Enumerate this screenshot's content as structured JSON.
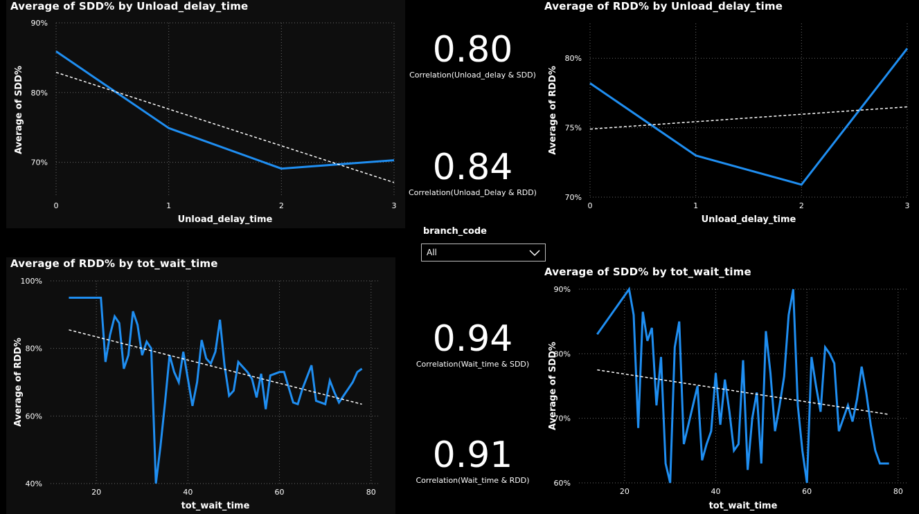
{
  "colors": {
    "line": "#1f8ef1",
    "trend": "#ffffff",
    "grid": "#6a6a6a",
    "panel": "#0e0e0e"
  },
  "cards": [
    {
      "value": "0.80",
      "label": "Correlation(Unload_delay & SDD)"
    },
    {
      "value": "0.84",
      "label": "Correlation(Unload_Delay & RDD)"
    },
    {
      "value": "0.94",
      "label": "Correlation(Wait_time & SDD)"
    },
    {
      "value": "0.91",
      "label": "Correlation(Wait_time & RDD)"
    }
  ],
  "slicer": {
    "title": "branch_code",
    "value": "All",
    "icon": "chevron-down-icon"
  },
  "chart_data": [
    {
      "type": "line",
      "title": "Average of SDD% by Unload_delay_time",
      "xlabel": "Unload_delay_time",
      "ylabel": "Average of SDD%",
      "xlim": [
        0,
        3
      ],
      "ylim": [
        65,
        90
      ],
      "xticks": [
        "0",
        "1",
        "2",
        "3"
      ],
      "yticks": [
        {
          "v": 70,
          "t": "70%"
        },
        {
          "v": 80,
          "t": "80%"
        },
        {
          "v": 90,
          "t": "90%"
        }
      ],
      "x": [
        0,
        1,
        2,
        3
      ],
      "series": [
        {
          "values": [
            85.9,
            74.9,
            69.1,
            70.3
          ]
        }
      ],
      "trend": [
        [
          0,
          82.9
        ],
        [
          3,
          67.1
        ]
      ],
      "grid": true
    },
    {
      "type": "line",
      "title": "Average of RDD% by Unload_delay_time",
      "xlabel": "Unload_delay_time",
      "ylabel": "Average of RDD%",
      "xlim": [
        0,
        3
      ],
      "ylim": [
        70,
        82.5
      ],
      "xticks": [
        "0",
        "1",
        "2",
        "3"
      ],
      "yticks": [
        {
          "v": 70,
          "t": "70%"
        },
        {
          "v": 75,
          "t": "75%"
        },
        {
          "v": 80,
          "t": "80%"
        }
      ],
      "x": [
        0,
        1,
        2,
        3
      ],
      "series": [
        {
          "values": [
            78.2,
            73.0,
            70.9,
            80.7
          ]
        }
      ],
      "trend": [
        [
          0,
          74.9
        ],
        [
          3,
          76.5
        ]
      ],
      "grid": true
    },
    {
      "type": "line",
      "title": "Average of RDD% by tot_wait_time",
      "xlabel": "tot_wait_time",
      "ylabel": "Average of RDD%",
      "xlim": [
        10,
        82
      ],
      "ylim": [
        40,
        100
      ],
      "xticks": [
        "20",
        "40",
        "60",
        "80"
      ],
      "xtickvals": [
        20,
        40,
        60,
        80
      ],
      "yticks": [
        {
          "v": 40,
          "t": "40%"
        },
        {
          "v": 60,
          "t": "60%"
        },
        {
          "v": 80,
          "t": "80%"
        },
        {
          "v": 100,
          "t": "100%"
        }
      ],
      "x": [
        14,
        15,
        16,
        17,
        18,
        19,
        20,
        21,
        22,
        23,
        24,
        25,
        26,
        27,
        28,
        29,
        30,
        31,
        32,
        33,
        34,
        35,
        36,
        37,
        38,
        39,
        40,
        41,
        42,
        43,
        44,
        45,
        46,
        47,
        48,
        49,
        50,
        51,
        52,
        53,
        54,
        55,
        56,
        57,
        58,
        59,
        60,
        61,
        62,
        63,
        64,
        65,
        66,
        67,
        68,
        69,
        70,
        71,
        72,
        73,
        74,
        75,
        76,
        77,
        78
      ],
      "series": [
        {
          "values": [
            95,
            95,
            95,
            95,
            95,
            95,
            95,
            95,
            76,
            84,
            89.5,
            87.5,
            74,
            78,
            91,
            87,
            78,
            82,
            80,
            40,
            51,
            64,
            78,
            73,
            70,
            79,
            71,
            63,
            70,
            82.5,
            77,
            75.5,
            79,
            88.5,
            75,
            66,
            67.5,
            76,
            74.5,
            73,
            71,
            65.5,
            72.5,
            62,
            72,
            72.5,
            73,
            73,
            68.5,
            64,
            63.5,
            68,
            71.5,
            75,
            64.5,
            64,
            63.5,
            70.5,
            67,
            64,
            66,
            68,
            70,
            73,
            74
          ]
        }
      ],
      "trend": [
        [
          14,
          85.5
        ],
        [
          78,
          63.5
        ]
      ],
      "grid": true
    },
    {
      "type": "line",
      "title": "Average of SDD% by tot_wait_time",
      "xlabel": "tot_wait_time",
      "ylabel": "Average of SDD%",
      "xlim": [
        10,
        82
      ],
      "ylim": [
        60,
        90
      ],
      "xticks": [
        "20",
        "40",
        "60",
        "80"
      ],
      "xtickvals": [
        20,
        40,
        60,
        80
      ],
      "yticks": [
        {
          "v": 60,
          "t": "60%"
        },
        {
          "v": 70,
          "t": "70%"
        },
        {
          "v": 80,
          "t": "80%"
        },
        {
          "v": 90,
          "t": "90%"
        }
      ],
      "x": [
        14,
        21,
        22,
        23,
        24,
        25,
        26,
        27,
        28,
        29,
        30,
        31,
        32,
        33,
        34,
        35,
        36,
        37,
        38,
        39,
        40,
        41,
        42,
        43,
        44,
        45,
        46,
        47,
        48,
        49,
        50,
        51,
        52,
        53,
        54,
        55,
        56,
        57,
        58,
        59,
        60,
        61,
        62,
        63,
        64,
        65,
        66,
        67,
        68,
        69,
        70,
        71,
        72,
        73,
        74,
        75,
        76,
        77,
        78
      ],
      "series": [
        {
          "values": [
            83,
            90,
            86,
            68.5,
            86.5,
            82,
            84,
            72,
            79.5,
            63,
            60,
            81,
            85,
            66,
            69,
            72,
            75,
            63.5,
            66,
            68,
            77,
            69,
            76,
            71,
            65,
            66,
            79,
            62,
            70,
            74,
            63,
            83.5,
            77,
            68,
            72,
            76.5,
            86,
            90,
            72,
            65,
            60,
            79.5,
            75,
            71,
            81,
            80,
            78.5,
            68,
            70,
            72,
            69.5,
            73,
            78,
            74,
            69,
            65,
            63,
            63,
            63
          ]
        }
      ],
      "trend": [
        [
          14,
          77.5
        ],
        [
          78,
          70.6
        ]
      ],
      "grid": true
    }
  ]
}
